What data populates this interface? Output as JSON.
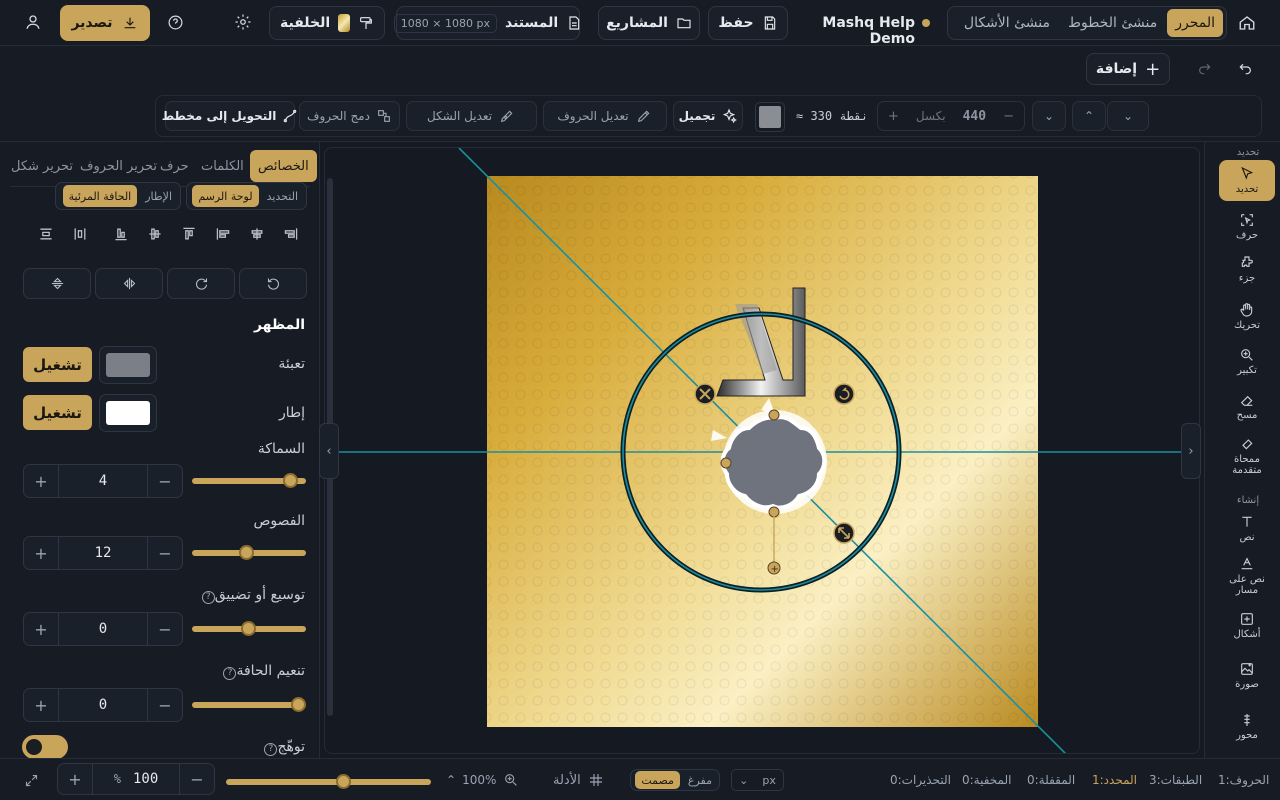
{
  "header": {
    "tabs": [
      {
        "label": "المحرر",
        "active": true
      },
      {
        "label": "منشئ الخطوط",
        "active": false
      },
      {
        "label": "منشئ الأشكال",
        "active": false
      }
    ],
    "project_name": "Mashq Help Demo",
    "save_label": "حفظ",
    "projects_label": "المشاريع",
    "document_label": "المستند",
    "document_size": "1080 × 1080 px",
    "background_label": "الخلفية",
    "export_label": "تصدير"
  },
  "row2": {
    "add_label": "إضافة"
  },
  "toolbar": {
    "width_value": "440",
    "width_unit": "بكسل",
    "points_text": "≈ 330 نقطة",
    "beautify_label": "تجميل",
    "edit_letters_label": "تعديل الحروف",
    "edit_shape_label": "تعديل الشكل",
    "merge_letters_label": "دمج الحروف",
    "convert_path_label": "التحويل إلى مخطط",
    "color": "#8a8d94"
  },
  "left_panel": {
    "tabs": [
      {
        "label": "الخصائص",
        "active": true
      },
      {
        "label": "الكلمات",
        "active": false
      },
      {
        "label": "حرف",
        "active": false
      },
      {
        "label": "تحرير الحروف",
        "active": false
      },
      {
        "label": "تحرير شكل",
        "active": false
      }
    ],
    "align_to": [
      {
        "label": "التحديد",
        "active": false
      },
      {
        "label": "لوحة الرسم",
        "active": true
      }
    ],
    "bbox_mode": [
      {
        "label": "الإطار",
        "active": false
      },
      {
        "label": "الحافة المرئية",
        "active": true
      }
    ],
    "appearance_title": "المظهر",
    "fill": {
      "label": "تعبئة",
      "button": "تشغيل",
      "color": "#7b7f87"
    },
    "stroke": {
      "label": "إطار",
      "button": "تشغيل",
      "color": "#ffffff"
    },
    "thickness": {
      "label": "السماكة",
      "value": "4",
      "fraction": 0.86
    },
    "lobes": {
      "label": "الفصوص",
      "value": "12",
      "fraction": 0.47
    },
    "expand": {
      "label": "توسيع أو تضييق",
      "value": "0",
      "fraction": 0.49
    },
    "smooth": {
      "label": "تنعيم الحافة",
      "value": "0",
      "fraction": 0.93
    },
    "glow": {
      "label": "توهّج",
      "enabled": false
    }
  },
  "right_tools": {
    "section_select": "تحديد",
    "items": [
      {
        "label": "تحديد",
        "icon": "cursor-icon",
        "active": true
      },
      {
        "label": "حرف",
        "icon": "letter-select-icon",
        "active": false
      },
      {
        "label": "جزء",
        "icon": "part-icon",
        "active": false
      },
      {
        "label": "تحريك",
        "icon": "hand-icon",
        "active": false
      },
      {
        "label": "تكبير",
        "icon": "zoom-icon",
        "active": false
      },
      {
        "label": "مسح",
        "icon": "eraser-icon",
        "active": false
      },
      {
        "label": "ممحاة متقدمة",
        "icon": "advanced-eraser-icon",
        "active": false
      }
    ],
    "section_create": "إنشاء",
    "create_items": [
      {
        "label": "نص",
        "icon": "text-icon"
      },
      {
        "label": "نص على مسار",
        "icon": "text-on-path-icon"
      },
      {
        "label": "أشكال",
        "icon": "shapes-icon"
      },
      {
        "label": "صورة",
        "icon": "image-icon"
      },
      {
        "label": "محور",
        "icon": "axis-icon"
      }
    ]
  },
  "status": {
    "letters": "الحروف:1",
    "layers": "الطبقات:3",
    "selected": "المحدد:1",
    "locked": "المقفلة:0",
    "hidden": "المخفية:0",
    "warnings": "التحذيرات:0",
    "unit": "px",
    "fill_modes": [
      {
        "label": "مفرغ",
        "active": false
      },
      {
        "label": "مصمت",
        "active": true
      }
    ],
    "guides_label": "الأدلة",
    "zoom_text": "100%",
    "zoom_fraction": 0.57,
    "zoom_input": "100",
    "zoom_unit": "%"
  }
}
